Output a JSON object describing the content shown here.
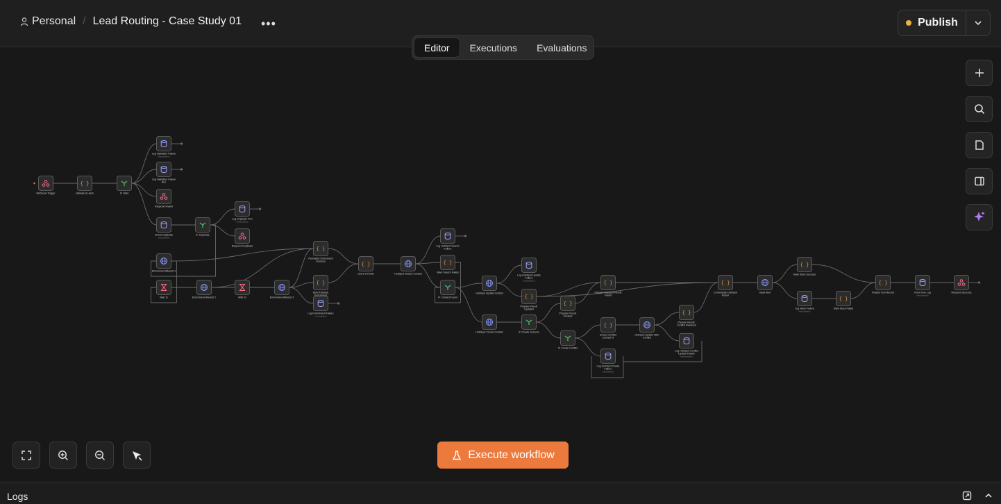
{
  "breadcrumb": {
    "project": "Personal",
    "workflow_name": "Lead Routing - Case Study 01",
    "more_icon": "ellipsis-icon"
  },
  "tabs": [
    {
      "label": "Editor",
      "active": true
    },
    {
      "label": "Executions",
      "active": false
    },
    {
      "label": "Evaluations",
      "active": false
    }
  ],
  "publish": {
    "label": "Publish",
    "status_color": "#e8b53a"
  },
  "execute": {
    "label": "Execute workflow",
    "color": "#ec7a3c"
  },
  "logs": {
    "label": "Logs"
  },
  "colors": {
    "canvas": "#181818",
    "node": "#2c2c2c",
    "code_icon": "#e8a04a",
    "http_icon": "#8a96ff",
    "if_icon": "#4fc46a",
    "webhook_icon": "#ff6d8a",
    "wait_icon": "#ff6d8a",
    "sheet_icon": "#9aa4ff"
  },
  "nodes": [
    {
      "id": "n1",
      "label": "Webhook Trigger",
      "icon": "webhook-icon"
    },
    {
      "id": "n2",
      "label": "Validate & Hash",
      "icon": "code-icon"
    },
    {
      "id": "n3",
      "label": "IF Valid",
      "icon": "if-icon"
    },
    {
      "id": "n4",
      "label": "Log Validation Failure",
      "sub": "execute(item)",
      "icon": "database-icon"
    },
    {
      "id": "n5",
      "label": "Log Validation Failure Run",
      "icon": "database-icon"
    },
    {
      "id": "n6",
      "label": "Respond Invalid",
      "icon": "webhook-icon"
    },
    {
      "id": "n7",
      "label": "Check Duplicate",
      "sub": "execute(item)",
      "icon": "database-icon"
    },
    {
      "id": "n8",
      "label": "IF Duplicate",
      "icon": "if-icon"
    },
    {
      "id": "n9",
      "label": "Log Duplicate Run",
      "sub": "execute(item)",
      "icon": "database-icon"
    },
    {
      "id": "n10",
      "label": "Respond Duplicate",
      "icon": "webhook-icon"
    },
    {
      "id": "n11",
      "label": "Enrichment Attempt 1",
      "icon": "globe-icon"
    },
    {
      "id": "n12",
      "label": "Wait 1s",
      "icon": "hourglass-icon"
    },
    {
      "id": "n13",
      "label": "Enrichment Attempt 2",
      "icon": "globe-icon"
    },
    {
      "id": "n14",
      "label": "Wait 2s",
      "icon": "hourglass-icon"
    },
    {
      "id": "n15",
      "label": "Enrichment Attempt 3",
      "icon": "globe-icon"
    },
    {
      "id": "n16",
      "label": "Normalize Enrichment Success",
      "icon": "code-icon"
    },
    {
      "id": "n17",
      "label": "Build Fallback Enrichment",
      "icon": "code-icon"
    },
    {
      "id": "n18",
      "label": "Log Enrichment Failure",
      "sub": "execute(item)",
      "icon": "database-icon"
    },
    {
      "id": "n19",
      "label": "Score & Route",
      "icon": "code-icon"
    },
    {
      "id": "n20",
      "label": "HubSpot Search Contact",
      "icon": "globe-icon"
    },
    {
      "id": "n21",
      "label": "Log HubSpot Search Failure",
      "icon": "database-icon"
    },
    {
      "id": "n22",
      "label": "Mark Search Failed",
      "icon": "code-icon"
    },
    {
      "id": "n23",
      "label": "IF Contact Found",
      "icon": "if-icon"
    },
    {
      "id": "n24",
      "label": "HubSpot Update Contact",
      "icon": "globe-icon"
    },
    {
      "id": "n25",
      "label": "HubSpot Create Contact",
      "icon": "globe-icon"
    },
    {
      "id": "n26",
      "label": "Log HubSpot Update Failure",
      "sub": "execute(item)",
      "icon": "database-icon"
    },
    {
      "id": "n27",
      "label": "Prepare Result: Updated",
      "icon": "code-icon"
    },
    {
      "id": "n28",
      "label": "IF Create Success",
      "icon": "if-icon"
    },
    {
      "id": "n29",
      "label": "Prepare Result: Created",
      "icon": "code-icon"
    },
    {
      "id": "n30",
      "label": "IF Create Conflict",
      "icon": "if-icon"
    },
    {
      "id": "n31",
      "label": "Prepare HubSpot Result Failed",
      "icon": "code-icon"
    },
    {
      "id": "n32",
      "label": "Extract Conflict Contact Id",
      "icon": "code-icon"
    },
    {
      "id": "n33",
      "label": "HubSpot Update After Conflict",
      "icon": "globe-icon"
    },
    {
      "id": "n34",
      "label": "Prepare Result: Conflict Resolved",
      "icon": "code-icon"
    },
    {
      "id": "n35",
      "label": "Log HubSpot Conflict Update Failure",
      "sub": "execute(item)",
      "icon": "database-icon"
    },
    {
      "id": "n36",
      "label": "Log HubSpot Create Failure",
      "sub": "execute(item)",
      "icon": "database-icon"
    },
    {
      "id": "n37",
      "label": "Consolidate HubSpot Result",
      "icon": "code-icon"
    },
    {
      "id": "n38",
      "label": "Slack Alert",
      "icon": "globe-icon"
    },
    {
      "id": "n39",
      "label": "Mark Slack Success",
      "icon": "code-icon"
    },
    {
      "id": "n40",
      "label": "Log Slack Failure",
      "sub": "execute(item)",
      "icon": "database-icon"
    },
    {
      "id": "n41",
      "label": "Mark Slack Failed",
      "icon": "code-icon"
    },
    {
      "id": "n42",
      "label": "Finalize Run Record",
      "icon": "code-icon"
    },
    {
      "id": "n43",
      "label": "Insert Run Log",
      "sub": "execute(item)",
      "icon": "database-icon"
    },
    {
      "id": "n44",
      "label": "Respond Success",
      "icon": "webhook-icon"
    }
  ]
}
